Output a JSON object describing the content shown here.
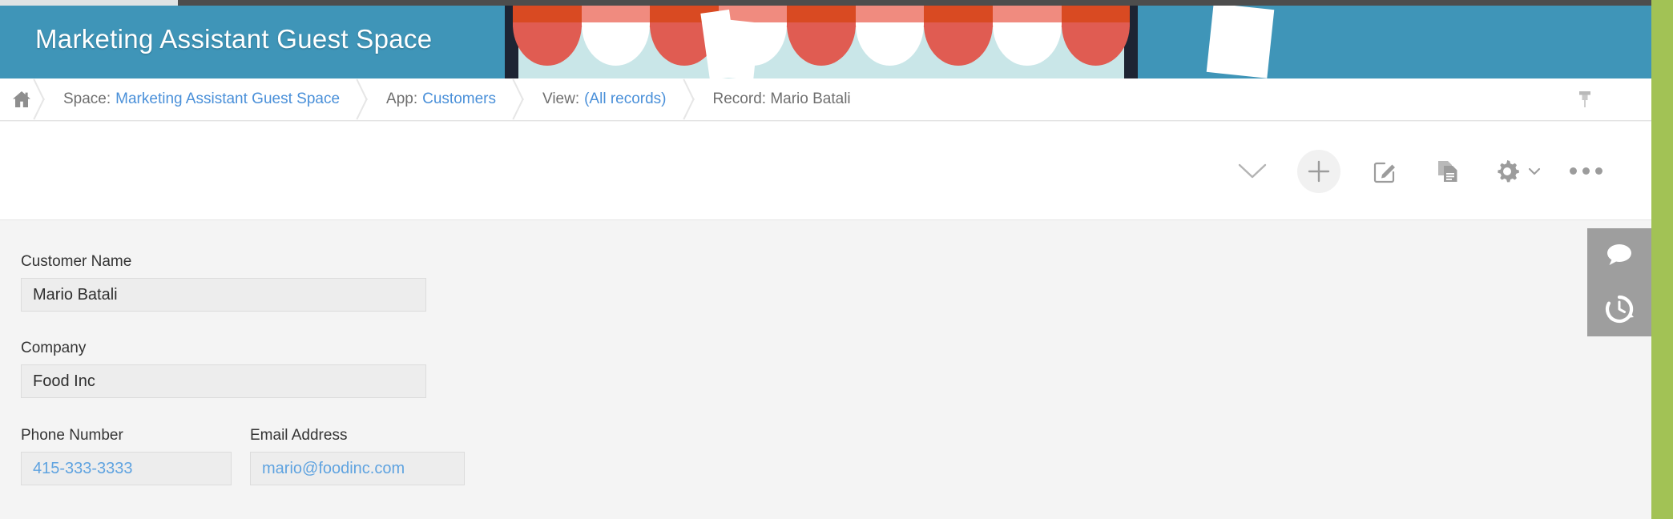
{
  "window": {
    "accent_blue": "#3f95b8",
    "rail_green": "#a2c255",
    "link_blue": "#4a90d9",
    "chrome_dark": "#4d4d4d"
  },
  "banner": {
    "title": "Marketing Assistant Guest Space",
    "illustration": "storefront-awning-illustration"
  },
  "breadcrumb": {
    "home_icon": "home-icon",
    "items": [
      {
        "prefix": "Space:",
        "link": "Marketing Assistant Guest Space"
      },
      {
        "prefix": "App:",
        "link": "Customers"
      },
      {
        "prefix": "View:",
        "link": "(All records)"
      },
      {
        "prefix": "Record: Mario Batali",
        "link": ""
      }
    ],
    "pin_icon": "pushpin-icon"
  },
  "toolbar": {
    "actions": [
      {
        "name": "chevron-down-icon",
        "label": "Collapse"
      },
      {
        "name": "plus-icon",
        "label": "Add"
      },
      {
        "name": "edit-icon",
        "label": "Edit"
      },
      {
        "name": "duplicate-icon",
        "label": "Duplicate"
      },
      {
        "name": "gear-icon",
        "label": "Settings"
      },
      {
        "name": "ellipsis-icon",
        "label": "More"
      }
    ]
  },
  "form": {
    "fields": [
      {
        "label": "Customer Name",
        "value": "Mario Batali",
        "style": "text"
      },
      {
        "label": "Company",
        "value": "Food Inc",
        "style": "text"
      },
      {
        "label": "Phone Number",
        "value": "415-333-3333",
        "style": "link"
      },
      {
        "label": "Email Address",
        "value": "mario@foodinc.com",
        "style": "link"
      }
    ]
  },
  "side_dock": {
    "buttons": [
      {
        "name": "comment-icon",
        "label": "Comments"
      },
      {
        "name": "history-icon",
        "label": "History"
      }
    ]
  }
}
